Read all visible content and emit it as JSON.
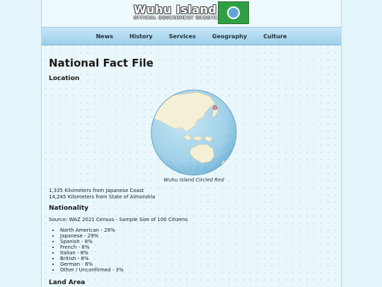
{
  "site": {
    "title": "Wuhu Island",
    "subtitle": "OFFICIAL GOVERNMENT WEBSITE"
  },
  "nav": [
    "News",
    "History",
    "Services",
    "Geography",
    "Culture"
  ],
  "page": {
    "heading": "National Fact File",
    "location": {
      "heading": "Location",
      "caption": "Wuhu Island Circled Red",
      "distances": [
        "1,335 Kilometers from Japanese Coast",
        "14,245 Kilometers from State of Almondria"
      ]
    },
    "nationality": {
      "heading": "Nationality",
      "source": "Source: WAZ 2021 Census - Sample Size of 100 Citizens",
      "items": [
        "North American - 29%",
        "Japanese - 29%",
        "Spanish - 8%",
        "French - 8%",
        "Italian - 8%",
        "British - 8%",
        "German - 8%",
        "Other / Unconfirmed - 3%"
      ]
    },
    "land_area": {
      "heading": "Land Area"
    }
  },
  "colors": {
    "flag_green": "#2ea043",
    "flag_ring": "#5fa6d6",
    "nav_gradient_top": "#c6e6f6",
    "nav_gradient_bottom": "#9fcfea",
    "page_background": "#eaf8fc",
    "ocean": "#9fd0e8",
    "land": "#f4f0d6",
    "marker": "#e0302f"
  }
}
